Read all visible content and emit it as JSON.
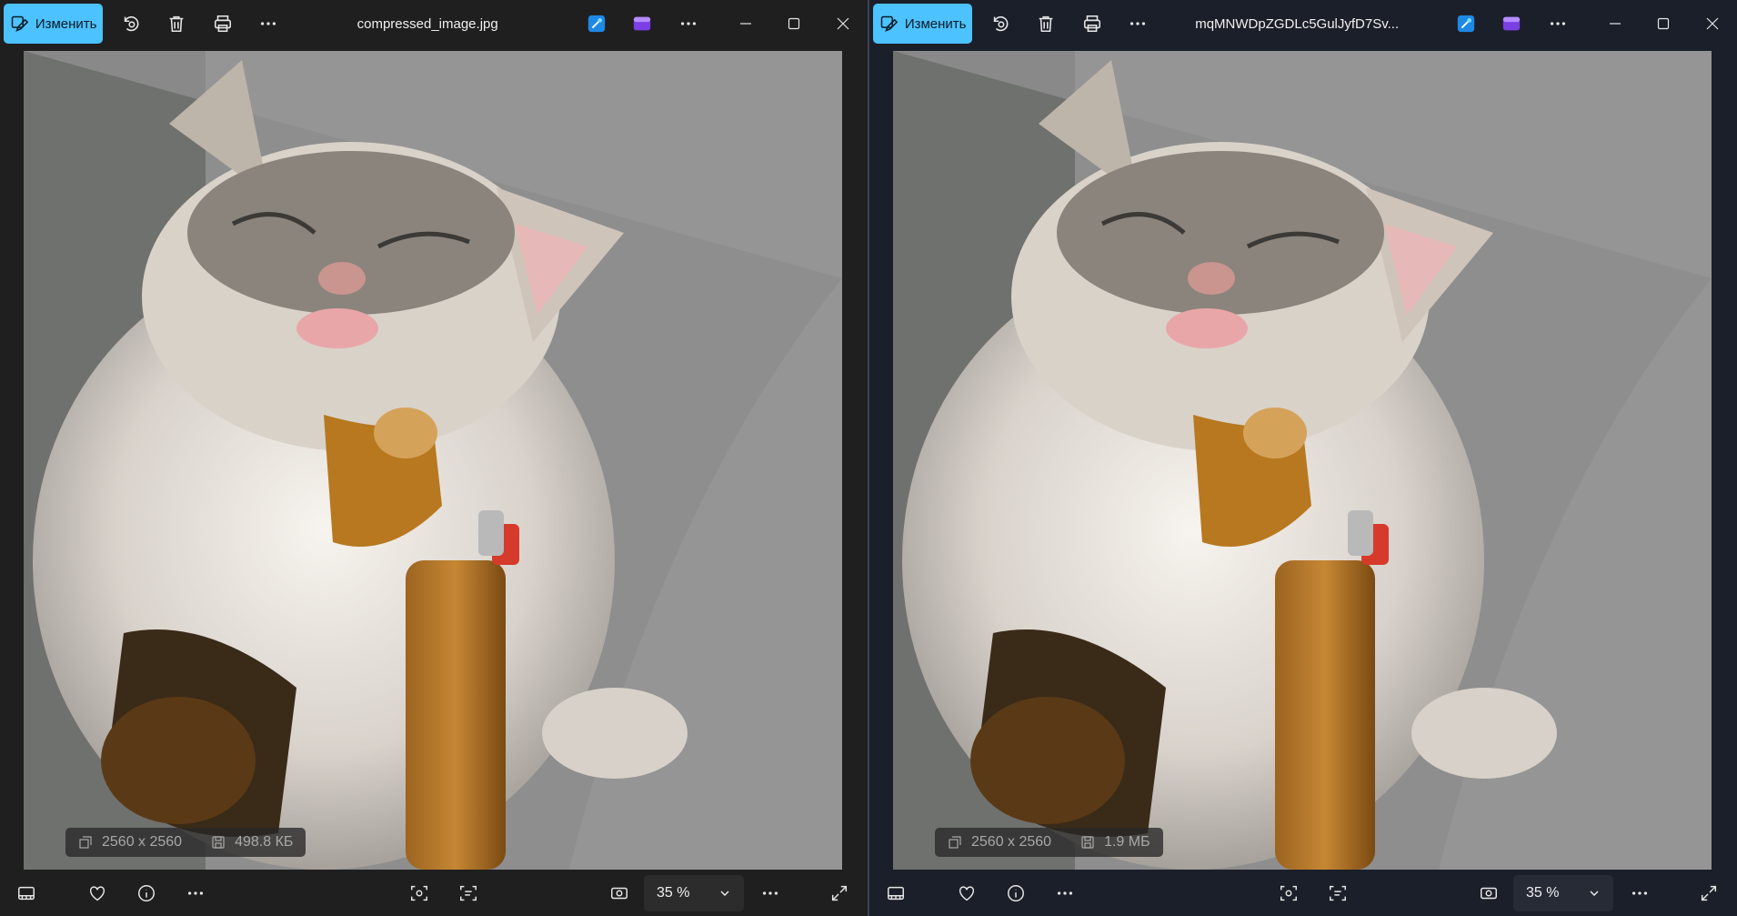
{
  "colors": {
    "accent": "#4cc2ff",
    "background": "#1f1f1f",
    "right_window_background": "#1b1f29"
  },
  "windows": [
    {
      "id": "left",
      "toolbar": {
        "edit_label": "Изменить",
        "filename": "compressed_image.jpg",
        "icons": [
          "edit-icon",
          "rotate-icon",
          "delete-icon",
          "print-icon",
          "more-icon",
          "designer-icon",
          "clipchamp-icon",
          "more-icon",
          "minimize-icon",
          "maximize-icon",
          "close-icon"
        ]
      },
      "image_info": {
        "dimensions": "2560 x 2560",
        "file_size": "498.8 КБ"
      },
      "bottom": {
        "zoom": "35 %",
        "icons": [
          "filmstrip-icon",
          "favorite-icon",
          "info-icon",
          "more-icon",
          "visual-search-icon",
          "text-scan-icon",
          "fit-icon",
          "zoom-dropdown-icon",
          "more-icon",
          "expand-icon"
        ]
      }
    },
    {
      "id": "right",
      "toolbar": {
        "edit_label": "Изменить",
        "filename": "mqMNWDpZGDLc5GulJyfD7Sv...",
        "icons": [
          "edit-icon",
          "rotate-icon",
          "delete-icon",
          "print-icon",
          "more-icon",
          "designer-icon",
          "clipchamp-icon",
          "more-icon",
          "minimize-icon",
          "maximize-icon",
          "close-icon"
        ]
      },
      "image_info": {
        "dimensions": "2560 x 2560",
        "file_size": "1.9 МБ"
      },
      "bottom": {
        "zoom": "35 %",
        "icons": [
          "filmstrip-icon",
          "favorite-icon",
          "info-icon",
          "more-icon",
          "visual-search-icon",
          "text-scan-icon",
          "fit-icon",
          "zoom-dropdown-icon",
          "more-icon",
          "expand-icon"
        ]
      }
    }
  ]
}
